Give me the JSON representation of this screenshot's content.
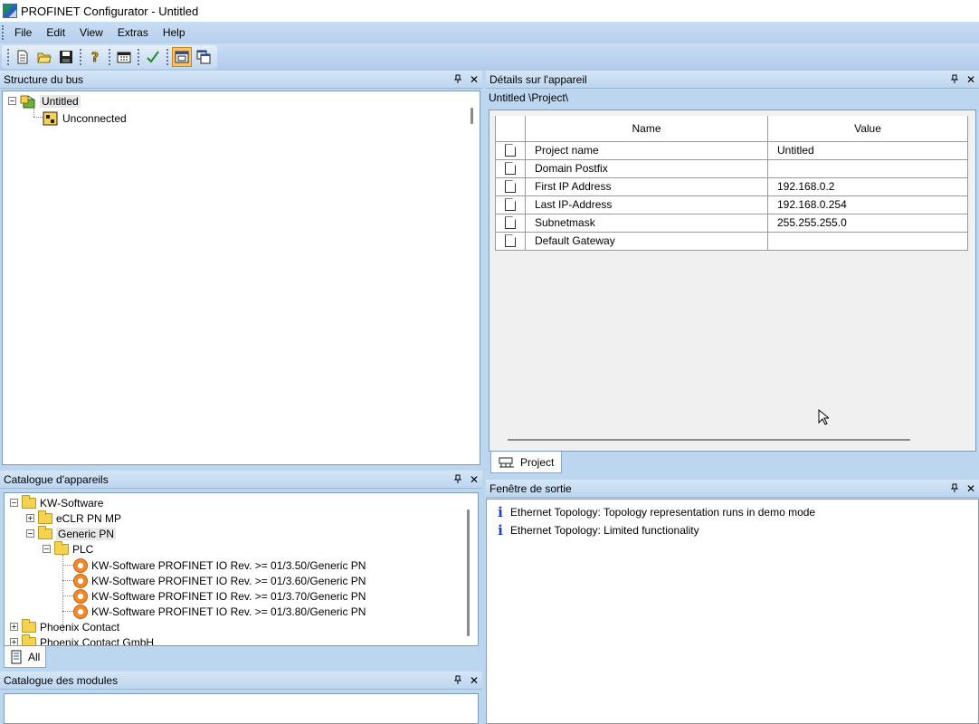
{
  "window": {
    "title": "PROFINET Configurator - Untitled"
  },
  "menu": [
    "File",
    "Edit",
    "View",
    "Extras",
    "Help"
  ],
  "toolbar": {
    "icons": [
      "new-icon",
      "open-icon",
      "save-icon",
      "help-icon",
      "calendar-icon",
      "check-icon",
      "window-icon",
      "cascade-icon"
    ]
  },
  "bus_structure": {
    "title": "Structure du bus",
    "root": "Untitled",
    "child": "Unconnected"
  },
  "device_details": {
    "title": "Détails sur l'appareil",
    "path": "Untitled \\Project\\",
    "columns": [
      "Name",
      "Value"
    ],
    "rows": [
      {
        "name": "Project name",
        "value": "Untitled"
      },
      {
        "name": "Domain Postfix",
        "value": ""
      },
      {
        "name": "First IP Address",
        "value": "192.168.0.2"
      },
      {
        "name": "Last IP-Address",
        "value": "192.168.0.254"
      },
      {
        "name": "Subnetmask",
        "value": "255.255.255.0"
      },
      {
        "name": "Default Gateway",
        "value": ""
      }
    ],
    "tab": "Project"
  },
  "device_catalog": {
    "title": "Catalogue d'appareils",
    "items": [
      "KW-Software",
      "eCLR PN MP",
      "Generic PN",
      "PLC",
      "KW-Software PROFINET IO Rev. >= 01/3.50/Generic PN",
      "KW-Software PROFINET IO Rev. >= 01/3.60/Generic PN",
      "KW-Software PROFINET IO Rev. >= 01/3.70/Generic PN",
      "KW-Software PROFINET IO Rev. >= 01/3.80/Generic PN",
      "Phoenix Contact",
      "Phoenix Contact GmbH"
    ],
    "tab": "All"
  },
  "module_catalog": {
    "title": "Catalogue des modules"
  },
  "output_window": {
    "title": "Fenêtre de sortie",
    "messages": [
      "Ethernet Topology: Topology representation runs in demo mode",
      "Ethernet Topology: Limited functionality"
    ]
  },
  "panel_icons": {
    "pin": "📌",
    "close": "✕"
  }
}
